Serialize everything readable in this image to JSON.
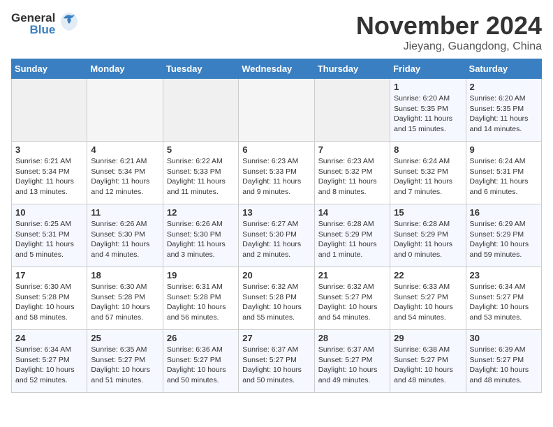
{
  "header": {
    "logo_general": "General",
    "logo_blue": "Blue",
    "month": "November 2024",
    "location": "Jieyang, Guangdong, China"
  },
  "weekdays": [
    "Sunday",
    "Monday",
    "Tuesday",
    "Wednesday",
    "Thursday",
    "Friday",
    "Saturday"
  ],
  "weeks": [
    [
      {
        "day": "",
        "info": ""
      },
      {
        "day": "",
        "info": ""
      },
      {
        "day": "",
        "info": ""
      },
      {
        "day": "",
        "info": ""
      },
      {
        "day": "",
        "info": ""
      },
      {
        "day": "1",
        "info": "Sunrise: 6:20 AM\nSunset: 5:35 PM\nDaylight: 11 hours\nand 15 minutes."
      },
      {
        "day": "2",
        "info": "Sunrise: 6:20 AM\nSunset: 5:35 PM\nDaylight: 11 hours\nand 14 minutes."
      }
    ],
    [
      {
        "day": "3",
        "info": "Sunrise: 6:21 AM\nSunset: 5:34 PM\nDaylight: 11 hours\nand 13 minutes."
      },
      {
        "day": "4",
        "info": "Sunrise: 6:21 AM\nSunset: 5:34 PM\nDaylight: 11 hours\nand 12 minutes."
      },
      {
        "day": "5",
        "info": "Sunrise: 6:22 AM\nSunset: 5:33 PM\nDaylight: 11 hours\nand 11 minutes."
      },
      {
        "day": "6",
        "info": "Sunrise: 6:23 AM\nSunset: 5:33 PM\nDaylight: 11 hours\nand 9 minutes."
      },
      {
        "day": "7",
        "info": "Sunrise: 6:23 AM\nSunset: 5:32 PM\nDaylight: 11 hours\nand 8 minutes."
      },
      {
        "day": "8",
        "info": "Sunrise: 6:24 AM\nSunset: 5:32 PM\nDaylight: 11 hours\nand 7 minutes."
      },
      {
        "day": "9",
        "info": "Sunrise: 6:24 AM\nSunset: 5:31 PM\nDaylight: 11 hours\nand 6 minutes."
      }
    ],
    [
      {
        "day": "10",
        "info": "Sunrise: 6:25 AM\nSunset: 5:31 PM\nDaylight: 11 hours\nand 5 minutes."
      },
      {
        "day": "11",
        "info": "Sunrise: 6:26 AM\nSunset: 5:30 PM\nDaylight: 11 hours\nand 4 minutes."
      },
      {
        "day": "12",
        "info": "Sunrise: 6:26 AM\nSunset: 5:30 PM\nDaylight: 11 hours\nand 3 minutes."
      },
      {
        "day": "13",
        "info": "Sunrise: 6:27 AM\nSunset: 5:30 PM\nDaylight: 11 hours\nand 2 minutes."
      },
      {
        "day": "14",
        "info": "Sunrise: 6:28 AM\nSunset: 5:29 PM\nDaylight: 11 hours\nand 1 minute."
      },
      {
        "day": "15",
        "info": "Sunrise: 6:28 AM\nSunset: 5:29 PM\nDaylight: 11 hours\nand 0 minutes."
      },
      {
        "day": "16",
        "info": "Sunrise: 6:29 AM\nSunset: 5:29 PM\nDaylight: 10 hours\nand 59 minutes."
      }
    ],
    [
      {
        "day": "17",
        "info": "Sunrise: 6:30 AM\nSunset: 5:28 PM\nDaylight: 10 hours\nand 58 minutes."
      },
      {
        "day": "18",
        "info": "Sunrise: 6:30 AM\nSunset: 5:28 PM\nDaylight: 10 hours\nand 57 minutes."
      },
      {
        "day": "19",
        "info": "Sunrise: 6:31 AM\nSunset: 5:28 PM\nDaylight: 10 hours\nand 56 minutes."
      },
      {
        "day": "20",
        "info": "Sunrise: 6:32 AM\nSunset: 5:28 PM\nDaylight: 10 hours\nand 55 minutes."
      },
      {
        "day": "21",
        "info": "Sunrise: 6:32 AM\nSunset: 5:27 PM\nDaylight: 10 hours\nand 54 minutes."
      },
      {
        "day": "22",
        "info": "Sunrise: 6:33 AM\nSunset: 5:27 PM\nDaylight: 10 hours\nand 54 minutes."
      },
      {
        "day": "23",
        "info": "Sunrise: 6:34 AM\nSunset: 5:27 PM\nDaylight: 10 hours\nand 53 minutes."
      }
    ],
    [
      {
        "day": "24",
        "info": "Sunrise: 6:34 AM\nSunset: 5:27 PM\nDaylight: 10 hours\nand 52 minutes."
      },
      {
        "day": "25",
        "info": "Sunrise: 6:35 AM\nSunset: 5:27 PM\nDaylight: 10 hours\nand 51 minutes."
      },
      {
        "day": "26",
        "info": "Sunrise: 6:36 AM\nSunset: 5:27 PM\nDaylight: 10 hours\nand 50 minutes."
      },
      {
        "day": "27",
        "info": "Sunrise: 6:37 AM\nSunset: 5:27 PM\nDaylight: 10 hours\nand 50 minutes."
      },
      {
        "day": "28",
        "info": "Sunrise: 6:37 AM\nSunset: 5:27 PM\nDaylight: 10 hours\nand 49 minutes."
      },
      {
        "day": "29",
        "info": "Sunrise: 6:38 AM\nSunset: 5:27 PM\nDaylight: 10 hours\nand 48 minutes."
      },
      {
        "day": "30",
        "info": "Sunrise: 6:39 AM\nSunset: 5:27 PM\nDaylight: 10 hours\nand 48 minutes."
      }
    ]
  ]
}
